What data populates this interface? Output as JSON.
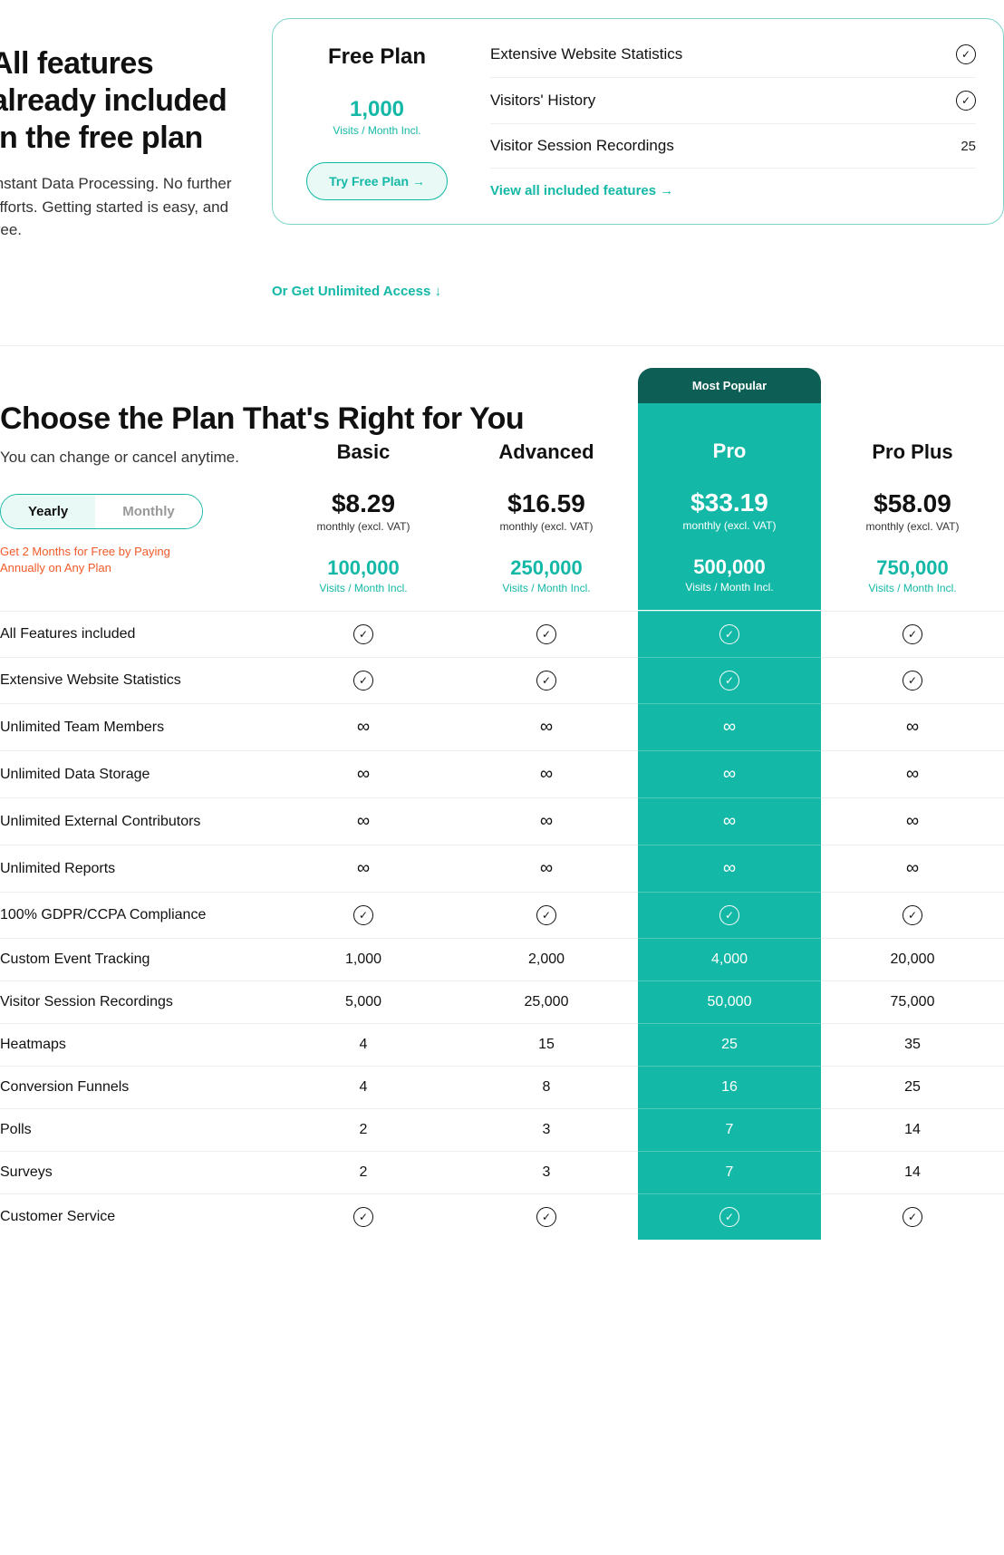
{
  "hero": {
    "title": "All features already included in the free plan",
    "sub": "Instant Data Processing. No further efforts. Getting started is easy, and free."
  },
  "free_plan": {
    "title": "Free Plan",
    "visits": "1,000",
    "visits_label": "Visits / Month Incl.",
    "cta": "Try Free Plan →",
    "features": [
      {
        "label": "Extensive Website Statistics",
        "value": "check"
      },
      {
        "label": "Visitors' History",
        "value": "check"
      },
      {
        "label": "Visitor Session Recordings",
        "value": "25"
      }
    ],
    "view_all": "View all included features →"
  },
  "unlimited_link": "Or Get Unlimited Access ↓",
  "plans": {
    "title": "Choose the Plan That's Right for You",
    "sub": "You can change or cancel anytime.",
    "period": {
      "yearly": "Yearly",
      "monthly": "Monthly"
    },
    "promo": "Get 2 Months for Free by Paying Annually on Any Plan",
    "price_note": "monthly (excl. VAT)",
    "visits_label": "Visits / Month Incl.",
    "popular_badge": "Most Popular",
    "columns": [
      {
        "name": "Basic",
        "price": "$8.29",
        "visits": "100,000",
        "popular": false
      },
      {
        "name": "Advanced",
        "price": "$16.59",
        "visits": "250,000",
        "popular": false
      },
      {
        "name": "Pro",
        "price": "$33.19",
        "visits": "500,000",
        "popular": true
      },
      {
        "name": "Pro Plus",
        "price": "$58.09",
        "visits": "750,000",
        "popular": false
      }
    ],
    "rows": [
      {
        "label": "All Features included",
        "vals": [
          "check",
          "check",
          "check",
          "check"
        ]
      },
      {
        "label": "Extensive Website Statistics",
        "vals": [
          "check",
          "check",
          "check",
          "check"
        ]
      },
      {
        "label": "Unlimited Team Members",
        "vals": [
          "inf",
          "inf",
          "inf",
          "inf"
        ]
      },
      {
        "label": "Unlimited Data Storage",
        "vals": [
          "inf",
          "inf",
          "inf",
          "inf"
        ]
      },
      {
        "label": "Unlimited External Contributors",
        "vals": [
          "inf",
          "inf",
          "inf",
          "inf"
        ]
      },
      {
        "label": "Unlimited Reports",
        "vals": [
          "inf",
          "inf",
          "inf",
          "inf"
        ]
      },
      {
        "label": "100% GDPR/CCPA Compliance",
        "vals": [
          "check",
          "check",
          "check",
          "check"
        ]
      },
      {
        "label": "Custom Event Tracking",
        "vals": [
          "1,000",
          "2,000",
          "4,000",
          "20,000"
        ]
      },
      {
        "label": "Visitor Session Recordings",
        "vals": [
          "5,000",
          "25,000",
          "50,000",
          "75,000"
        ]
      },
      {
        "label": "Heatmaps",
        "vals": [
          "4",
          "15",
          "25",
          "35"
        ]
      },
      {
        "label": "Conversion Funnels",
        "vals": [
          "4",
          "8",
          "16",
          "25"
        ]
      },
      {
        "label": "Polls",
        "vals": [
          "2",
          "3",
          "7",
          "14"
        ]
      },
      {
        "label": "Surveys",
        "vals": [
          "2",
          "3",
          "7",
          "14"
        ]
      },
      {
        "label": "Customer Service",
        "vals": [
          "check",
          "check",
          "check",
          "check"
        ]
      }
    ]
  }
}
